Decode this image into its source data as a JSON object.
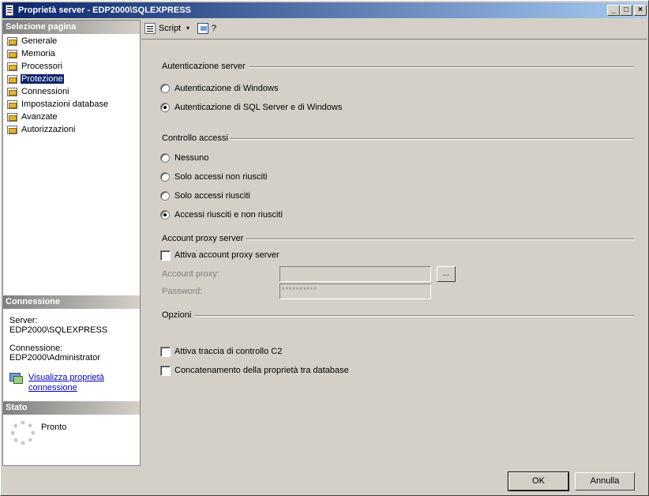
{
  "window": {
    "title": "Proprietà server - EDP2000\\SQLEXPRESS",
    "controls": {
      "minimize": "_",
      "maximize": "□",
      "close": "×"
    }
  },
  "left": {
    "select_page_header": "Selezione pagina",
    "pages": [
      {
        "label": "Generale",
        "icon": "page-icon",
        "selected": false
      },
      {
        "label": "Memoria",
        "icon": "page-icon",
        "selected": false
      },
      {
        "label": "Processori",
        "icon": "page-icon",
        "selected": false
      },
      {
        "label": "Protezione",
        "icon": "page-icon",
        "selected": true
      },
      {
        "label": "Connessioni",
        "icon": "page-icon",
        "selected": false
      },
      {
        "label": "Impostazioni database",
        "icon": "page-icon",
        "selected": false
      },
      {
        "label": "Avanzate",
        "icon": "page-icon",
        "selected": false
      },
      {
        "label": "Autorizzazioni",
        "icon": "page-icon",
        "selected": false
      }
    ],
    "connection": {
      "header": "Connessione",
      "server_label": "Server:",
      "server_value": "EDP2000\\SQLEXPRESS",
      "conn_label": "Connessione:",
      "conn_value": "EDP2000\\Administrator",
      "link_line1": "Visualizza proprietà",
      "link_line2": "connessione"
    },
    "status": {
      "header": "Stato",
      "text": "Pronto"
    }
  },
  "toolbar": {
    "script_label": "Script",
    "script_arrow": "▾",
    "help_label": "?"
  },
  "auth": {
    "title": "Autenticazione server",
    "options": [
      {
        "label": "Autenticazione di Windows",
        "checked": false
      },
      {
        "label": "Autenticazione di SQL Server e di Windows",
        "checked": true
      }
    ]
  },
  "access": {
    "title": "Controllo accessi",
    "options": [
      {
        "label": "Nessuno",
        "checked": false
      },
      {
        "label": "Solo accessi non riusciti",
        "checked": false
      },
      {
        "label": "Solo accessi riusciti",
        "checked": false
      },
      {
        "label": "Accessi riusciti e non riusciti",
        "checked": true
      }
    ]
  },
  "proxy": {
    "title": "Account proxy server",
    "enable_label": "Attiva account proxy server",
    "enable_checked": false,
    "account_label": "Account proxy:",
    "account_value": "",
    "browse_label": "...",
    "password_label": "Password:",
    "password_value": "**********"
  },
  "options": {
    "title": "Opzioni",
    "items": [
      {
        "label": "Attiva traccia di controllo C2",
        "checked": false
      },
      {
        "label": "Concatenamento della proprietà tra database",
        "checked": false
      }
    ]
  },
  "buttons": {
    "ok": "OK",
    "cancel": "Annulla"
  }
}
